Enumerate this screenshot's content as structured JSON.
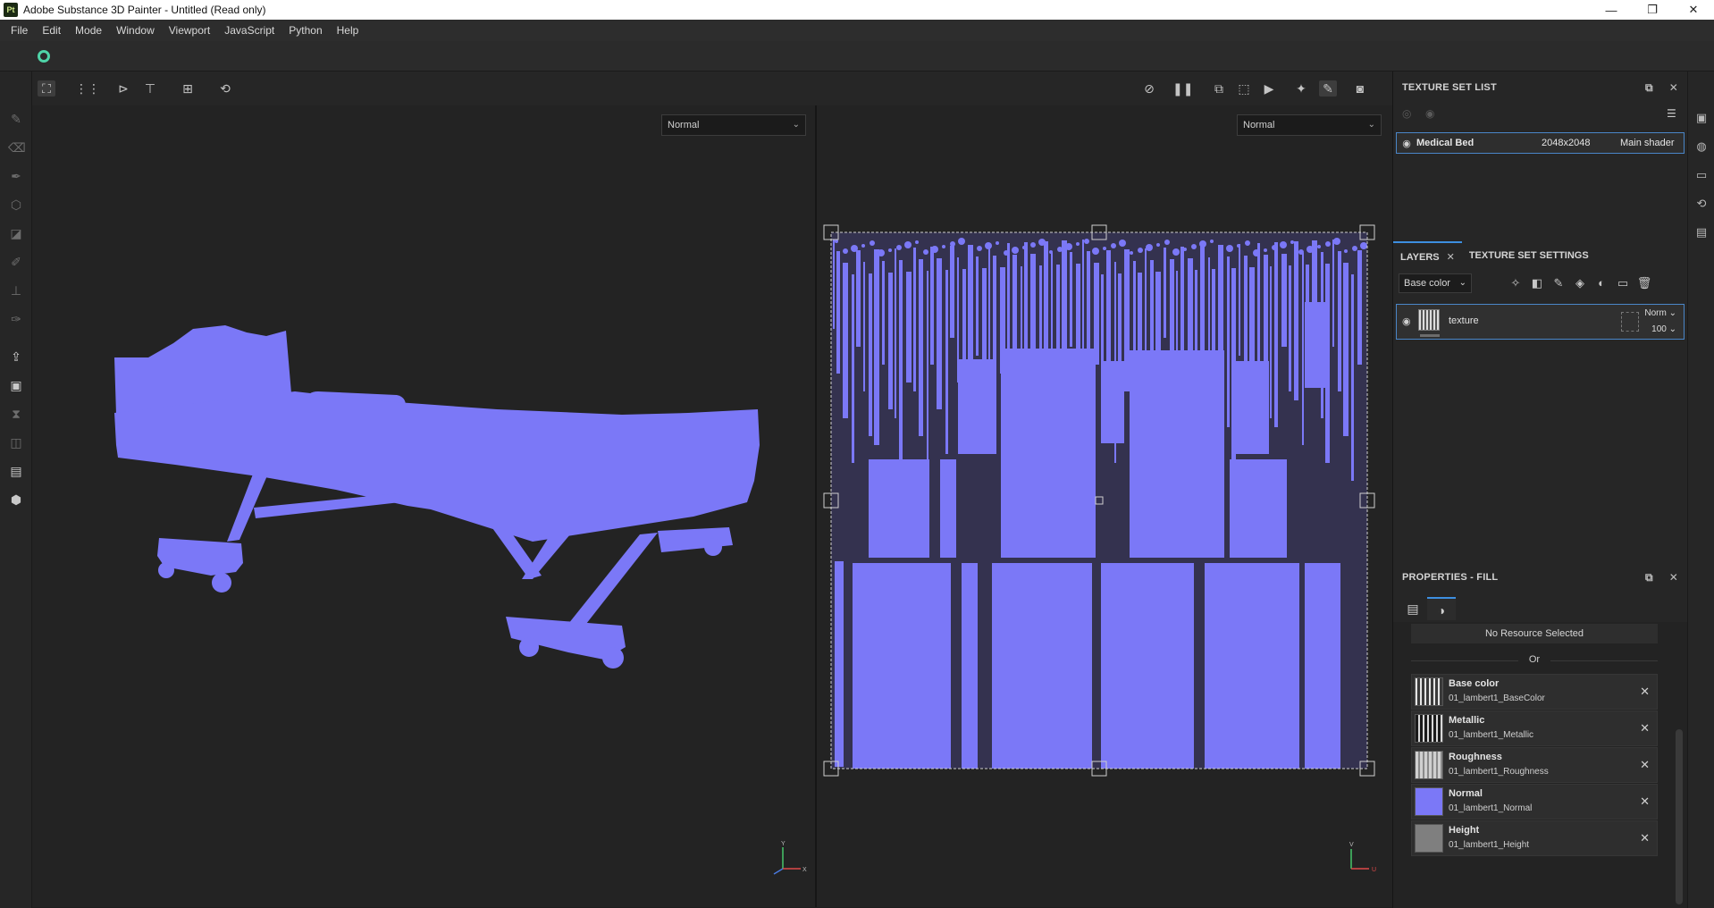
{
  "window": {
    "app_badge": "Pt",
    "title": "Adobe Substance 3D Painter - Untitled (Read only)",
    "minimize": "—",
    "maximize": "❐",
    "close": "✕"
  },
  "menu": [
    "File",
    "Edit",
    "Mode",
    "Window",
    "Viewport",
    "JavaScript",
    "Python",
    "Help"
  ],
  "viewports": {
    "left_mode": "Normal",
    "right_mode": "Normal",
    "mesh_color": "#7b78f7"
  },
  "texture_set_list": {
    "title": "TEXTURE SET LIST",
    "row": {
      "name": "Medical Bed",
      "resolution": "2048x2048",
      "shader": "Main shader"
    }
  },
  "layers": {
    "tabs": [
      {
        "label": "LAYERS",
        "close": "✕"
      },
      {
        "label": "TEXTURE SET SETTINGS"
      }
    ],
    "channel": "Base color",
    "layer": {
      "name": "texture",
      "blend": "Norm",
      "opacity": "100"
    }
  },
  "properties": {
    "title": "PROPERTIES - FILL",
    "no_resource": "No Resource Selected",
    "or": "Or",
    "channels": [
      {
        "name": "Base color",
        "file": "01_lambert1_BaseColor",
        "thumb_color": "#8a8a8a"
      },
      {
        "name": "Metallic",
        "file": "01_lambert1_Metallic",
        "thumb_color": "#3a3a3a"
      },
      {
        "name": "Roughness",
        "file": "01_lambert1_Roughness",
        "thumb_color": "#b5b5b5"
      },
      {
        "name": "Normal",
        "file": "01_lambert1_Normal",
        "thumb_color": "#7b78f7"
      },
      {
        "name": "Height",
        "file": "01_lambert1_Height",
        "thumb_color": "#7f7f7f"
      }
    ]
  },
  "axes": {
    "y": "Y",
    "x": "X",
    "v": "V",
    "u": "U"
  }
}
